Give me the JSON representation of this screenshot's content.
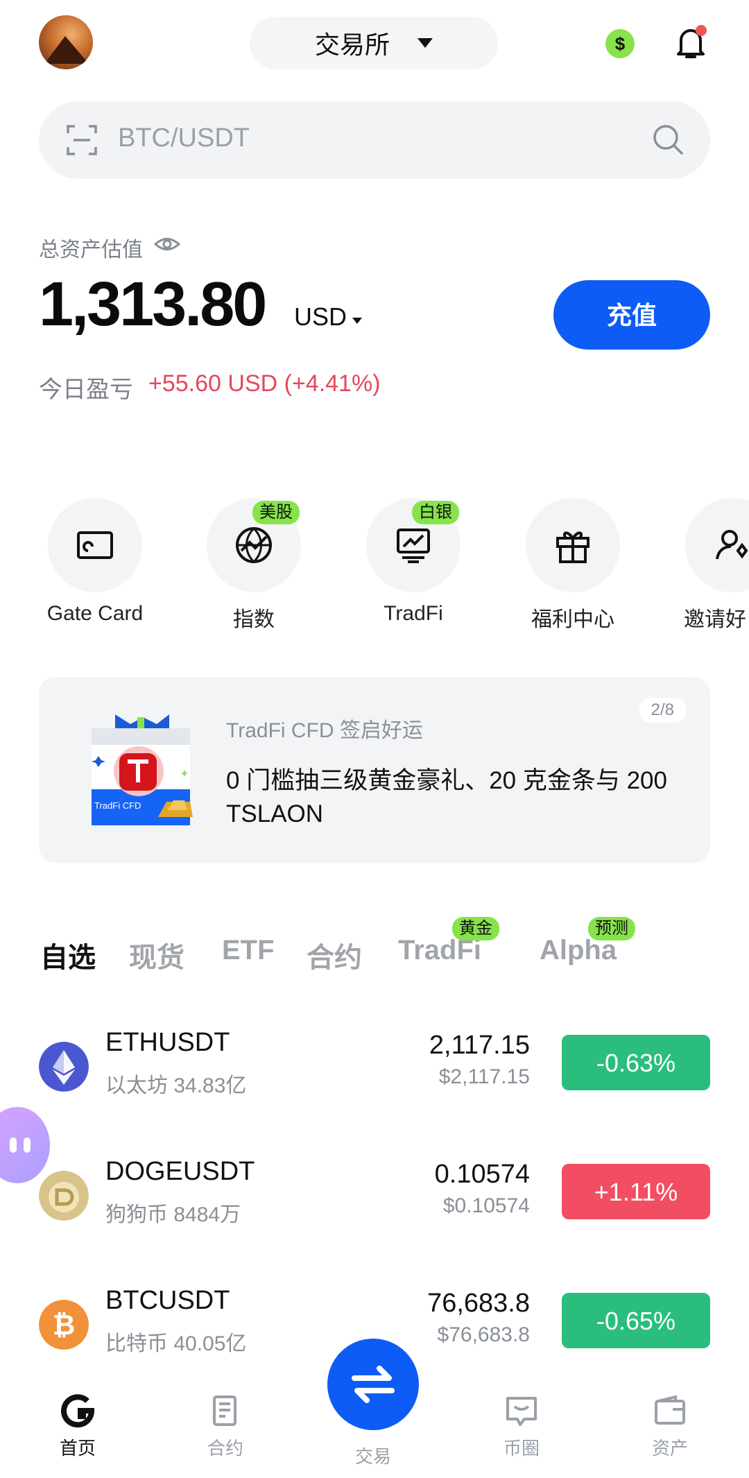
{
  "header": {
    "exchange_label": "交易所",
    "currency_badge": "$"
  },
  "search": {
    "placeholder": "BTC/USDT"
  },
  "assets": {
    "label": "总资产估值",
    "value": "1,313.80",
    "currency": "USD",
    "deposit_label": "充值",
    "pnl_label": "今日盈亏",
    "pnl_value": "+55.60 USD (+4.41%)"
  },
  "shortcuts": [
    {
      "label": "Gate Card",
      "icon": "card-icon",
      "badge": ""
    },
    {
      "label": "指数",
      "icon": "globe-icon",
      "badge": "美股"
    },
    {
      "label": "TradFi",
      "icon": "chart-monitor-icon",
      "badge": "白银"
    },
    {
      "label": "福利中心",
      "icon": "gift-icon",
      "badge": ""
    },
    {
      "label": "邀请好",
      "icon": "invite-user-icon",
      "badge": ""
    }
  ],
  "banner": {
    "subtitle": "TradFi CFD 签启好运",
    "title": "0 门槛抽三级黄金豪礼、20 克金条与 200 TSLAON",
    "page": "2/8",
    "image_text": "TradFi CFD"
  },
  "tabs": [
    {
      "label": "自选",
      "active": true,
      "badge": ""
    },
    {
      "label": "现货",
      "active": false,
      "badge": ""
    },
    {
      "label": "ETF",
      "active": false,
      "badge": ""
    },
    {
      "label": "合约",
      "active": false,
      "badge": ""
    },
    {
      "label": "TradFi",
      "active": false,
      "badge": "黄金"
    },
    {
      "label": "Alpha",
      "active": false,
      "badge": "预测"
    }
  ],
  "list": [
    {
      "symbol": "ETHUSDT",
      "sub": "以太坊 34.83亿",
      "price": "2,117.15",
      "price_usd": "$2,117.15",
      "change": "-0.63%",
      "trend": "down",
      "icon": "eth-icon"
    },
    {
      "symbol": "DOGEUSDT",
      "sub": "狗狗币 8484万",
      "price": "0.10574",
      "price_usd": "$0.10574",
      "change": "+1.11%",
      "trend": "up",
      "icon": "doge-icon"
    },
    {
      "symbol": "BTCUSDT",
      "sub": "比特币 40.05亿",
      "price": "76,683.8",
      "price_usd": "$76,683.8",
      "change": "-0.65%",
      "trend": "down",
      "icon": "btc-icon"
    }
  ],
  "nav": [
    {
      "label": "首页",
      "icon": "home-icon",
      "active": true
    },
    {
      "label": "合约",
      "icon": "contract-icon",
      "active": false
    },
    {
      "label": "交易",
      "icon": "swap-icon",
      "active": false
    },
    {
      "label": "币圈",
      "icon": "chat-icon",
      "active": false
    },
    {
      "label": "资产",
      "icon": "wallet-icon",
      "active": false
    }
  ],
  "colors": {
    "brand_blue": "#0d5cf5",
    "up_red": "#f24e63",
    "down_green": "#2bbd7e",
    "badge_green": "#86e34a"
  }
}
